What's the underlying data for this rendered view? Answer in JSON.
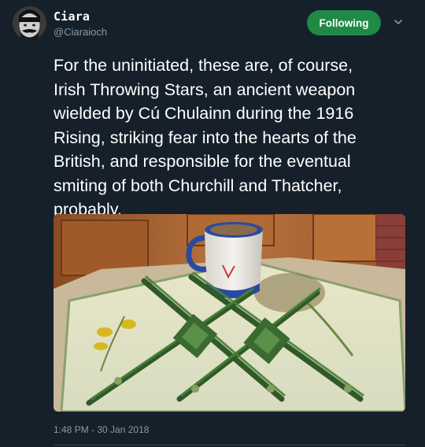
{
  "user": {
    "display_name": "Ciara",
    "handle": "@Ciaraioch"
  },
  "follow_button": {
    "label": "Following"
  },
  "tweet": {
    "text_lines": [
      "For the uninitiated, these are, of course,",
      "Irish Throwing Stars, an ancient weapon",
      "wielded by Cú Chulainn during the 1916",
      "Rising, striking fear into the hearts of the",
      "British, and responsible for the eventual",
      "smiting of both Churchill and Thatcher,",
      "probably."
    ],
    "timestamp": "1:48 PM - 30 Jan 2018"
  },
  "icons": {
    "more": "chevron-down-icon"
  },
  "colors": {
    "background": "#15202b",
    "follow_button": "#1e8a45",
    "secondary_text": "#8899a6"
  }
}
